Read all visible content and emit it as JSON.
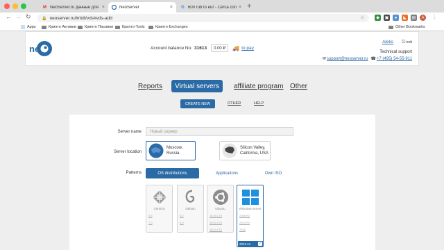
{
  "browser": {
    "tabs": [
      {
        "label": "NeoServer.ru данные для входа",
        "icon": "gmail-icon",
        "active": false
      },
      {
        "label": "NeoServer",
        "icon": "neoserver-icon",
        "active": true
      },
      {
        "label": "600 rub to eur - Cerca con Goo...",
        "icon": "google-icon",
        "active": false
      }
    ],
    "url": "neoserver.ru/lmtdl/vds#vds-add",
    "bookmarks": [
      {
        "label": "Apps",
        "icon": "apps-grid-icon"
      },
      {
        "label": "Крипто Активни",
        "icon": "folder-icon"
      },
      {
        "label": "Крипто Пасивни",
        "icon": "folder-icon"
      },
      {
        "label": "Крипто-Tools",
        "icon": "folder-icon"
      },
      {
        "label": "Крипто Exchanges",
        "icon": "folder-icon"
      }
    ],
    "other_bookmarks": "Other Bookmarks"
  },
  "header": {
    "account_label": "Account balance No.",
    "account_no": "31613",
    "balance": "0.00 ₽",
    "pay_link": "to pay",
    "user": "Aleks",
    "exit": "exit",
    "tech_support": "Technical support",
    "email": "support@neoserver.ru",
    "phone": "+7 (495) 54-55-911"
  },
  "nav": {
    "reports": "Reports",
    "virtual_servers": "Virtual servers",
    "affiliate": "affiliate program",
    "other": "Other"
  },
  "subnav": {
    "create_new": "CREATE NEW",
    "other": "OTHER",
    "help": "HELP"
  },
  "form": {
    "server_name_label": "Server name",
    "server_name_placeholder": "Новый сервер",
    "server_location_label": "Server location",
    "locations": [
      {
        "line1": "Moscow,",
        "line2": "Russia",
        "selected": true
      },
      {
        "line1": "Silicon Valley,",
        "line2": "California, USA",
        "selected": false
      }
    ],
    "patterns_label": "Patterns",
    "pattern_tabs": {
      "os": "OS distributions",
      "apps": "Applications",
      "own_iso": "Own ISO"
    },
    "os_list": [
      {
        "name": "CentOS",
        "versions": [
          "6.8",
          "7.0"
        ]
      },
      {
        "name": "Debian",
        "versions": [
          "8.2",
          "9.0"
        ]
      },
      {
        "name": "Ubuntu",
        "versions": [
          "14.04 LTS",
          "16.04 LTS",
          "18.04 LTS"
        ]
      },
      {
        "name": "Windows server",
        "versions": [
          "2008 R2",
          "2012 R2",
          "2016",
          "2019 en"
        ],
        "selected_version": "2019 en"
      }
    ]
  },
  "colors": {
    "accent": "#2a6aa5",
    "page_bg": "#eeeeee",
    "card_bg": "#ffffff"
  }
}
